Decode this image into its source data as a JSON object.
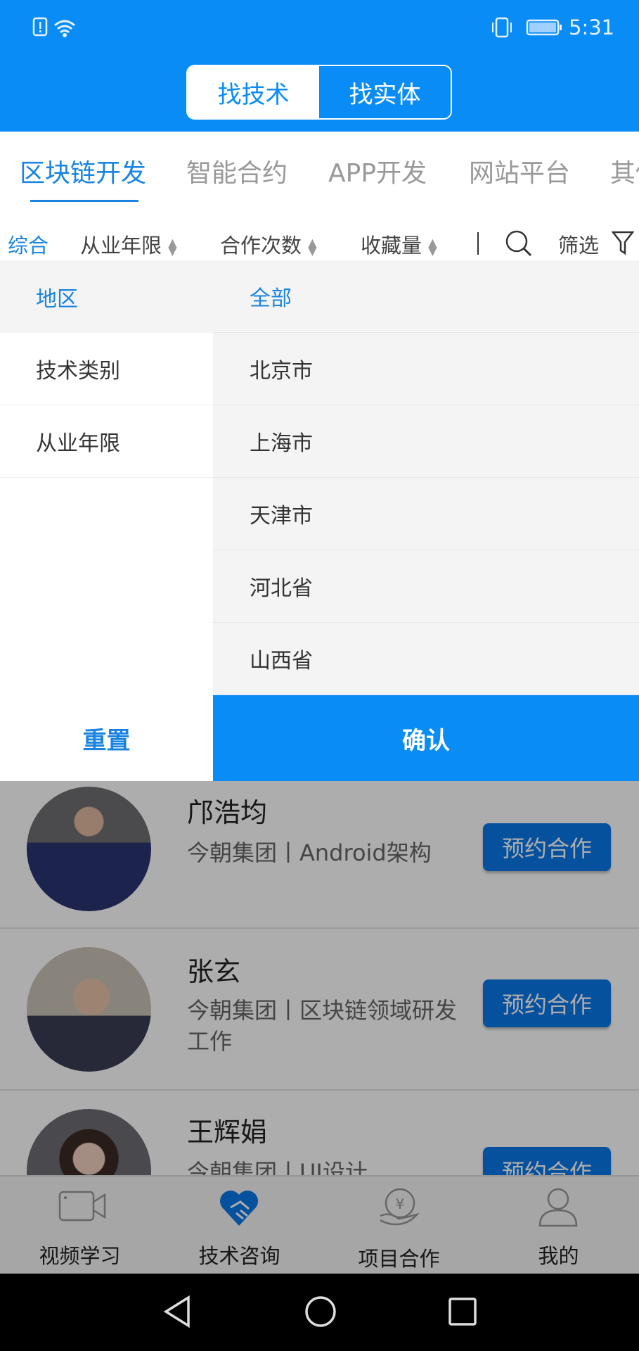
{
  "status_bar": {
    "time": "5:31",
    "icons": [
      "sim-alert-icon",
      "wifi-icon",
      "vibrate-icon",
      "battery-icon"
    ]
  },
  "segment": {
    "options": [
      "找技术",
      "找实体"
    ],
    "selected": "找技术"
  },
  "category_tabs": [
    "区块链开发",
    "智能合约",
    "APP开发",
    "网站平台",
    "其他"
  ],
  "active_tab": "区块链开发",
  "sort_bar": {
    "items": [
      "综合",
      "从业年限",
      "合作次数",
      "收藏量"
    ],
    "filter": "筛选",
    "icons": [
      "sort-arrows-icon",
      "search-icon",
      "filter-icon"
    ]
  },
  "filter_panel": {
    "categories": [
      "地区",
      "技术类别",
      "从业年限"
    ],
    "selected_category": "地区",
    "options": [
      "全部",
      "北京市",
      "上海市",
      "天津市",
      "河北省",
      "山西省"
    ],
    "selected_option": "全部",
    "reset": "重置",
    "confirm": "确认"
  },
  "experts": [
    {
      "name": "邝浩均",
      "desc": "今朝集团丨Android架构",
      "action": "预约合作"
    },
    {
      "name": "张玄",
      "desc": "今朝集团丨区块链领域研发工作",
      "action": "预约合作"
    },
    {
      "name": "王辉娟",
      "desc": "今朝集团丨UI设计",
      "action": "预约合作"
    }
  ],
  "bottom_nav": [
    {
      "label": "视频学习",
      "icon": "video-camera-icon"
    },
    {
      "label": "技术咨询",
      "icon": "heart-handshake-icon",
      "active": true
    },
    {
      "label": "项目合作",
      "icon": "coin-hand-icon"
    },
    {
      "label": "我的",
      "icon": "person-icon"
    }
  ],
  "colors": {
    "primary": "#0a8cf7",
    "accent_text": "#1a84e0",
    "button": "#0a78e8"
  }
}
